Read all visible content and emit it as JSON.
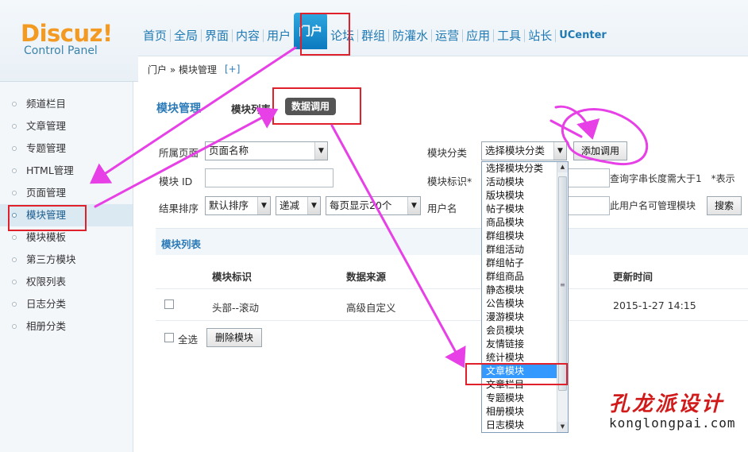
{
  "header": {
    "logo": "Discuz!",
    "logo_sub": "Control Panel",
    "nav": [
      "首页",
      "全局",
      "界面",
      "内容",
      "用户",
      "门户",
      "论坛",
      "群组",
      "防灌水",
      "运营",
      "应用",
      "工具",
      "站长",
      "UCenter"
    ],
    "active_nav": "门户",
    "breadcrumb": "门户 » 模块管理",
    "breadcrumb_plus": "[+]"
  },
  "sidebar": {
    "items": [
      {
        "label": "频道栏目"
      },
      {
        "label": "文章管理"
      },
      {
        "label": "专题管理"
      },
      {
        "label": "HTML管理"
      },
      {
        "label": "页面管理"
      },
      {
        "label": "模块管理",
        "active": true
      },
      {
        "label": "模块模板"
      },
      {
        "label": "第三方模块"
      },
      {
        "label": "权限列表"
      },
      {
        "label": "日志分类"
      },
      {
        "label": "相册分类"
      }
    ]
  },
  "main": {
    "title": "模块管理",
    "tab_list": "模块列表",
    "tab_call": "数据调用",
    "filters": {
      "page_label": "所属页面",
      "page_value": "页面名称",
      "module_id_label": "模块 ID",
      "sort_label": "结果排序",
      "sort_value": "默认排序",
      "order_value": "递减",
      "perpage_value": "每页显示20个",
      "category_label": "模块分类",
      "category_value": "选择模块分类",
      "add_call_button": "添加调用",
      "tag_label": "模块标识*",
      "tag_hint": "查询字串长度需大于1　*表示",
      "user_label": "用户名",
      "user_hint": "此用户名可管理模块",
      "search_button": "搜索"
    },
    "list_title": "模块列表",
    "table": {
      "headers": [
        "模块标识",
        "数据来源",
        "更新时间"
      ],
      "rows": [
        {
          "tag": "头部--滚动",
          "source": "高级自定义",
          "updated": "2015-1-27 14:15"
        }
      ]
    },
    "select_all_label": "全选",
    "delete_button": "删除模块"
  },
  "dropdown": {
    "options": [
      "选择模块分类",
      "活动模块",
      "版块模块",
      "帖子模块",
      "商品模块",
      "群组模块",
      "群组活动",
      "群组帖子",
      "群组商品",
      "静态模块",
      "公告模块",
      "漫游模块",
      "会员模块",
      "友情链接",
      "统计模块",
      "文章模块",
      "文章栏目",
      "专题模块",
      "相册模块",
      "日志模块"
    ],
    "highlighted": "文章模块"
  },
  "watermark": {
    "cn": "孔龙派设计",
    "en": "konglongpai.com"
  },
  "colors": {
    "accent": "#2b7ab8",
    "annotation_red": "#e0202a",
    "annotation_arrow": "#e640e6"
  }
}
